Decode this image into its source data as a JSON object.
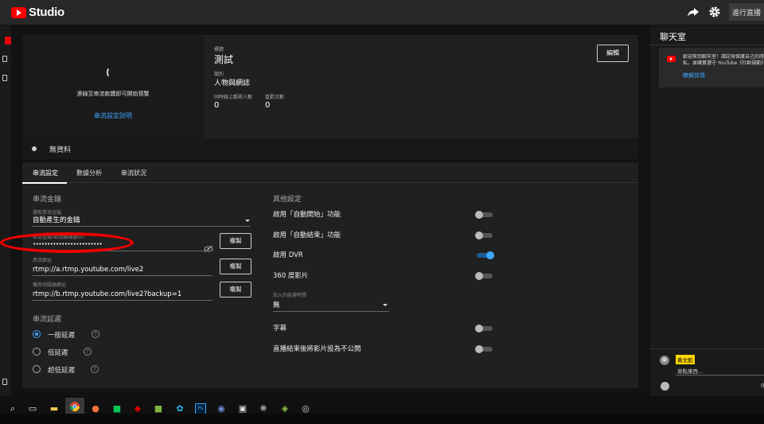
{
  "topbar": {
    "logo_text": "Studio",
    "live_button": "進行直播"
  },
  "preview": {
    "message": "連線至串流軟體即可開始預覽",
    "link": "串流設定說明"
  },
  "info": {
    "title_label": "標題",
    "title": "測試",
    "category_label": "類別",
    "category": "人物與網誌",
    "viewers_label": "同時線上觀眾人數",
    "viewers": "0",
    "likes_label": "喜歡次數",
    "likes": "0",
    "edit_button": "編輯"
  },
  "status": {
    "text": "無資料"
  },
  "tabs": [
    "串流設定",
    "數據分析",
    "串流狀況"
  ],
  "stream_key": {
    "section_title": "串流金鑰",
    "select_label": "選取串流金鑰",
    "select_value": "自動產生的金鑰",
    "key_label": "串流金鑰(貼到編碼器中)",
    "key_value": "••••••••••••••••••••••••",
    "copy": "複製",
    "url_label": "串流網址",
    "url_value": "rtmp://a.rtmp.youtube.com/live2",
    "backup_label": "備用伺服器網址",
    "backup_value": "rtmp://b.rtmp.youtube.com/live2?backup=1"
  },
  "latency": {
    "section_title": "串流延遲",
    "options": [
      "一般延遲",
      "低延遲",
      "超低延遲"
    ],
    "selected": "一般延遲"
  },
  "other": {
    "section_title": "其他設定",
    "toggles": [
      {
        "label": "啟用「自動開始」功能",
        "on": false
      },
      {
        "label": "啟用「自動結束」功能",
        "on": false
      },
      {
        "label": "啟用 DVR",
        "on": true
      },
      {
        "label": "360 度影片",
        "on": false
      }
    ],
    "delay_label": "加入的延遲時間",
    "delay_value": "無",
    "captions_label": "字幕",
    "private_label": "直播結束後將影片設為不公開",
    "captions_on": false,
    "private_on": false
  },
  "chat": {
    "title": "聊天室",
    "notice_line1": "歡迎來到聊天室！請記得保護自己的隱",
    "notice_line2": "私，並確實遵守 YouTube《社群規範》",
    "notice_link": "瞭解詳情",
    "user_name": "黃文凱",
    "input_placeholder": "寫點東西...",
    "counter": "0"
  },
  "colors": {
    "accent": "#3ea6ff",
    "brand": "#ff0000",
    "annotation": "#e00000"
  }
}
